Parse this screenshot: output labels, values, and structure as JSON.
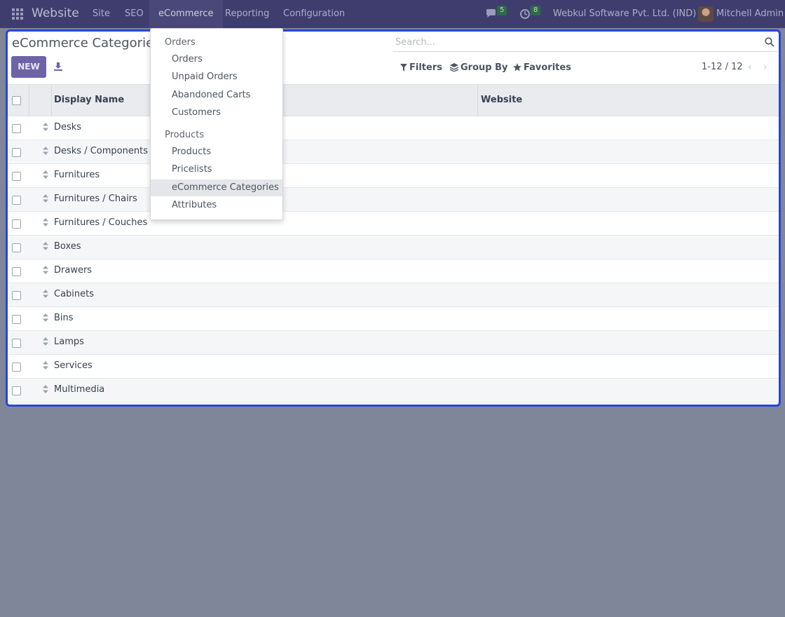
{
  "navbar": {
    "brand": "Website",
    "menu": [
      "Site",
      "SEO",
      "eCommerce",
      "Reporting",
      "Configuration"
    ],
    "active_menu": "eCommerce",
    "messages_count": "5",
    "activities_count": "8",
    "company": "Webkul Software Pvt. Ltd. (IND)",
    "user": "Mitchell Admin"
  },
  "page": {
    "title": "eCommerce Categories",
    "new_label": "NEW",
    "search_placeholder": "Search...",
    "filters_label": "Filters",
    "group_by_label": "Group By",
    "favorites_label": "Favorites",
    "pager": "1-12 / 12"
  },
  "table": {
    "columns": [
      "Display Name",
      "Website"
    ],
    "rows": [
      "Desks",
      "Desks / Components",
      "Furnitures",
      "Furnitures / Chairs",
      "Furnitures / Couches",
      "Boxes",
      "Drawers",
      "Cabinets",
      "Bins",
      "Lamps",
      "Services",
      "Multimedia"
    ]
  },
  "dropdown": {
    "orders_header": "Orders",
    "orders_items": [
      "Orders",
      "Unpaid Orders",
      "Abandoned Carts",
      "Customers"
    ],
    "products_header": "Products",
    "products_items": [
      "Products",
      "Pricelists",
      "eCommerce Categories",
      "Attributes"
    ],
    "selected": "eCommerce Categories"
  },
  "colors": {
    "navbar": "#3f3d6e",
    "primary_button": "#6f63a8",
    "badge": "#2e6a47",
    "panel_border": "#2746d8",
    "backdrop": "#7f8699"
  }
}
